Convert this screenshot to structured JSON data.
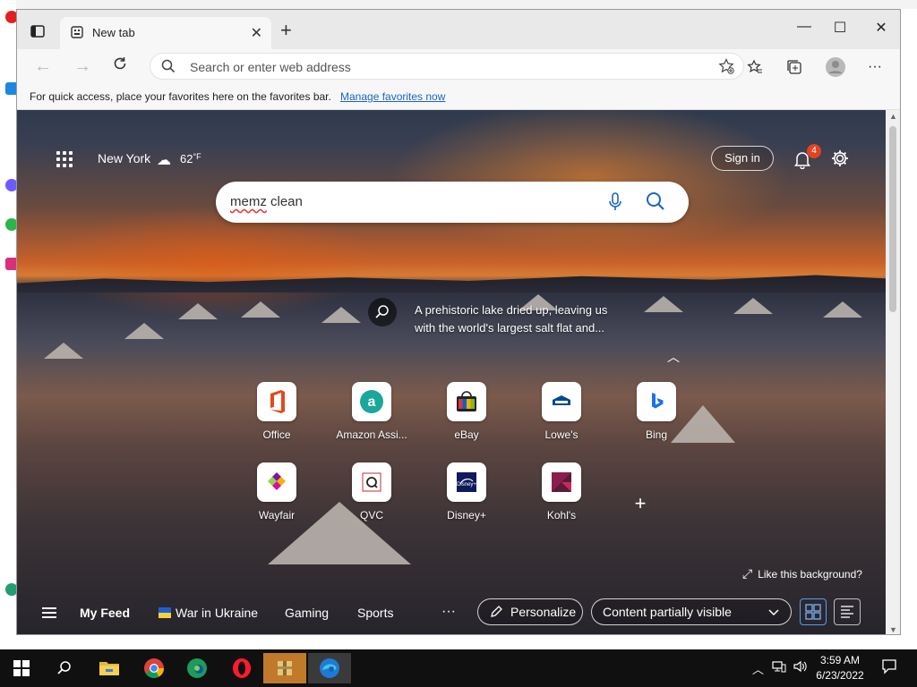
{
  "browser": {
    "tab_title": "New tab",
    "address_placeholder": "Search or enter web address",
    "favorites_bar_text": "For quick access, place your favorites here on the favorites bar.",
    "favorites_bar_link": "Manage favorites now"
  },
  "ntp": {
    "weather_city": "New York",
    "weather_temp": "62",
    "weather_unit": "°F",
    "sign_in_label": "Sign in",
    "notification_count": "4",
    "search_query": "memz clean",
    "search_query_misspelled": "memz",
    "search_query_rest": " clean",
    "image_caption": "A prehistoric lake dried up, leaving us with the world's largest salt flat and...",
    "like_background": "Like this background?"
  },
  "quick_links": [
    {
      "label": "Office",
      "icon": "office-icon"
    },
    {
      "label": "Amazon Assi...",
      "icon": "amazon-assistant-icon"
    },
    {
      "label": "eBay",
      "icon": "ebay-icon"
    },
    {
      "label": "Lowe's",
      "icon": "lowes-icon"
    },
    {
      "label": "Bing",
      "icon": "bing-icon"
    },
    {
      "label": "Wayfair",
      "icon": "wayfair-icon"
    },
    {
      "label": "QVC",
      "icon": "qvc-icon"
    },
    {
      "label": "Disney+",
      "icon": "disney-plus-icon"
    },
    {
      "label": "Kohl's",
      "icon": "kohls-icon"
    }
  ],
  "feed_bar": {
    "items": [
      "My Feed",
      "War in Ukraine",
      "Gaming",
      "Sports"
    ],
    "more": "···",
    "personalize": "Personalize",
    "content_visibility": "Content partially visible"
  },
  "taskbar": {
    "time": "3:59 AM",
    "date": "6/23/2022"
  },
  "colors": {
    "accent_link": "#1a66c2",
    "notification_badge": "#e0451f",
    "taskbar_bg": "#101010"
  }
}
